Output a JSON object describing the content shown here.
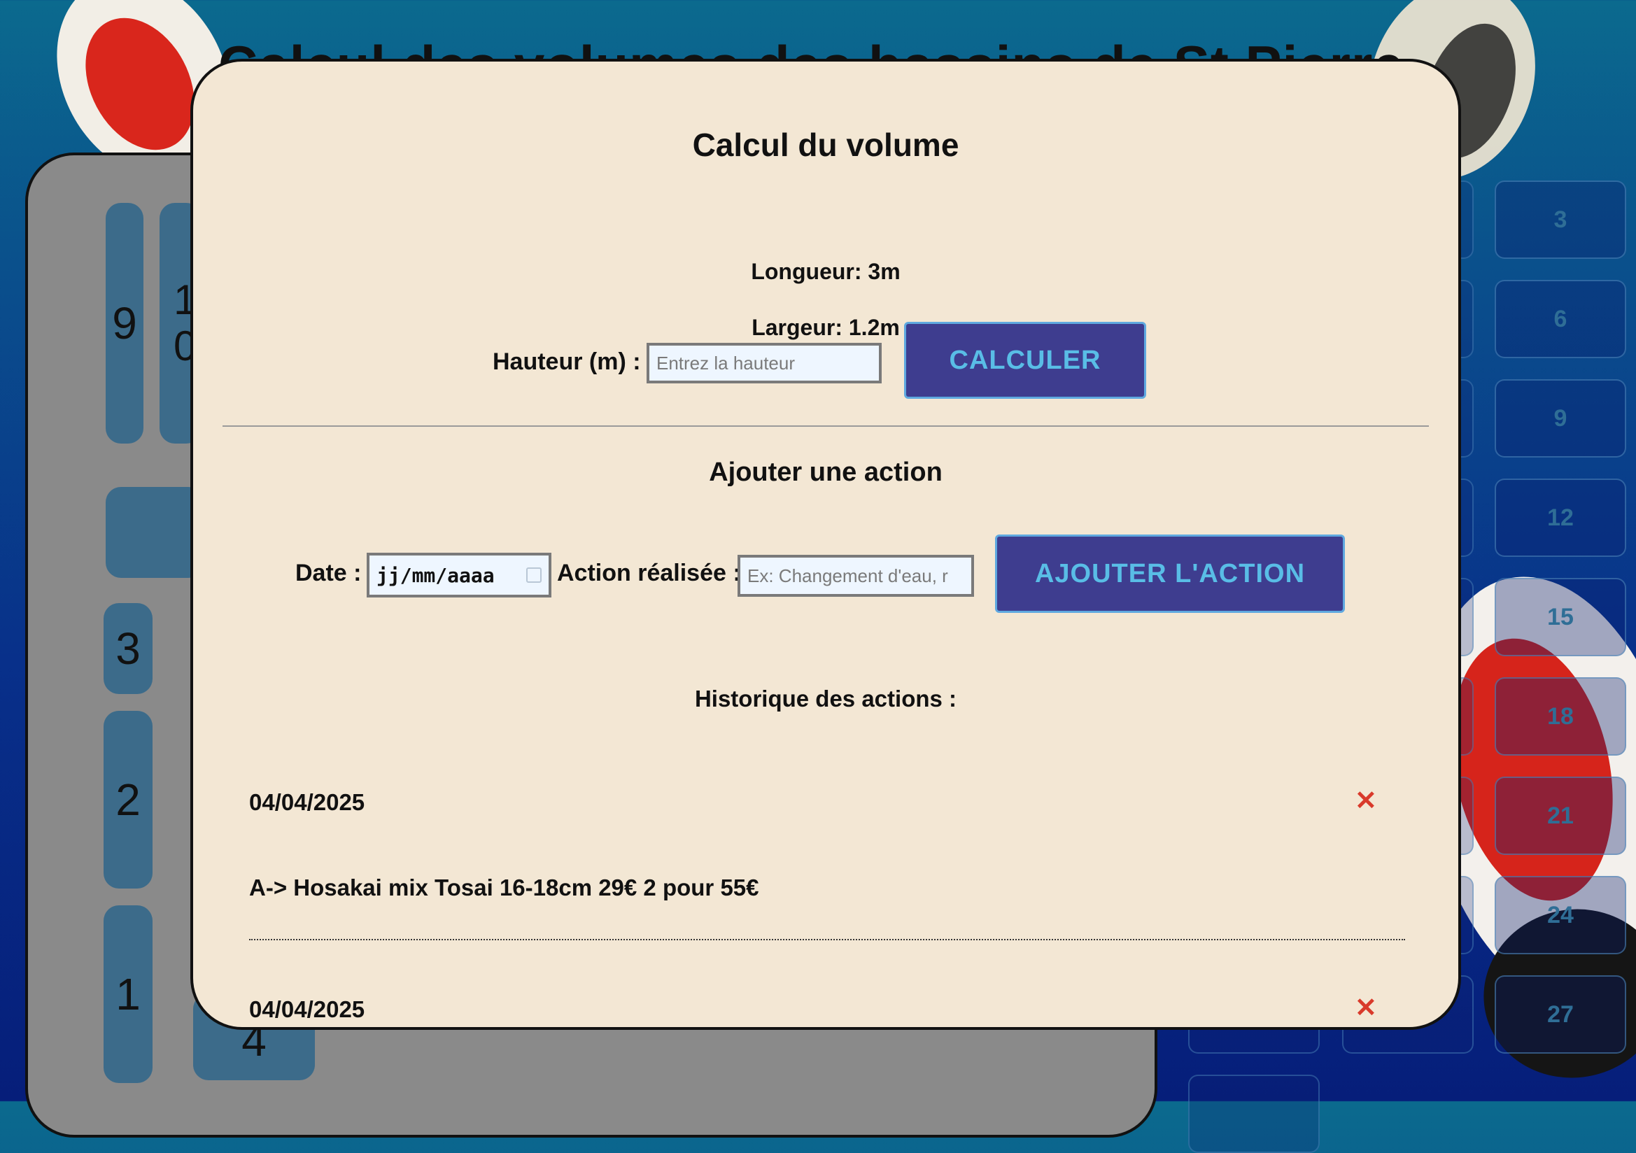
{
  "background": {
    "title": "Calcul des volumes des bassins de St Pierre",
    "tiles": [
      "9",
      "10",
      "3",
      "2",
      "1",
      "4"
    ],
    "grid_numbers": [
      "3",
      "6",
      "9",
      "12",
      "15",
      "18",
      "21",
      "24",
      "27"
    ]
  },
  "modal": {
    "title": "Calcul du volume",
    "length": "Longueur: 3m",
    "width": "Largeur: 1.2m",
    "height_label": "Hauteur (m) :",
    "height_placeholder": "Entrez la hauteur",
    "calc_button": "CALCULER",
    "add_title": "Ajouter une action",
    "date_label": "Date :",
    "date_placeholder": "jj/mm/aaaa",
    "action_label": "Action réalisée :",
    "action_placeholder": "Ex: Changement d'eau, r",
    "add_button": "AJOUTER L'ACTION",
    "history_title": "Historique des actions :",
    "entries": [
      {
        "date": "04/04/2025",
        "text": "A-> Hosakai mix Tosai 16-18cm 29€ 2 pour 55€",
        "delete": "✕"
      },
      {
        "date": "04/04/2025",
        "text": "",
        "delete": "✕"
      }
    ]
  },
  "colors": {
    "modal_bg": "#f3e7d4",
    "button_bg": "#3e3d8f",
    "button_text": "#59bde6",
    "delete": "#d93a2b"
  }
}
